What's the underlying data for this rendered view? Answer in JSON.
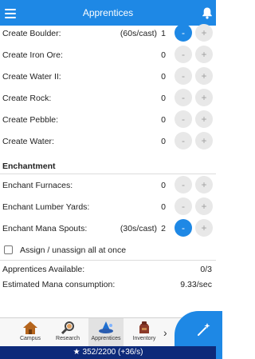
{
  "header": {
    "title": "Apprentices",
    "menu_icon": "hamburger-menu-icon",
    "bell_icon": "bell-icon"
  },
  "rows_top": [
    {
      "name": "Create Boulder:",
      "rate": "(60s/cast)",
      "count": "1",
      "active": true
    },
    {
      "name": "Create Iron Ore:",
      "rate": "",
      "count": "0",
      "active": false
    },
    {
      "name": "Create Water II:",
      "rate": "",
      "count": "0",
      "active": false
    },
    {
      "name": "Create Rock:",
      "rate": "",
      "count": "0",
      "active": false
    },
    {
      "name": "Create Pebble:",
      "rate": "",
      "count": "0",
      "active": false
    },
    {
      "name": "Create Water:",
      "rate": "",
      "count": "0",
      "active": false
    }
  ],
  "enchantment": {
    "heading": "Enchantment",
    "rows": [
      {
        "name": "Enchant Furnaces:",
        "rate": "",
        "count": "0",
        "active": false
      },
      {
        "name": "Enchant Lumber Yards:",
        "rate": "",
        "count": "0",
        "active": false
      },
      {
        "name": "Enchant Mana Spouts:",
        "rate": "(30s/cast)",
        "count": "2",
        "active": true
      }
    ]
  },
  "buttons": {
    "minus": "-",
    "plus": "+"
  },
  "assign": {
    "label": "Assign / unassign all at once",
    "checked": false
  },
  "info": {
    "available_label": "Apprentices Available:",
    "available_value": "0/3",
    "mana_label": "Estimated Mana consumption:",
    "mana_value": "9.33/sec"
  },
  "nav": {
    "items": [
      {
        "label": "Campus",
        "icon": "campus-icon"
      },
      {
        "label": "Research",
        "icon": "research-icon"
      },
      {
        "label": "Apprentices",
        "icon": "apprentices-icon",
        "active": true
      },
      {
        "label": "Inventory",
        "icon": "inventory-icon"
      }
    ],
    "more": "›"
  },
  "fab": {
    "icon": "magic-wand-icon"
  },
  "status": {
    "mana_text": "352/2200 (+36/s)",
    "icon": "star-icon"
  },
  "colors": {
    "accent": "#1e88e5",
    "status_bar": "#0d2a7a",
    "button_idle": "#e8e8e8"
  }
}
